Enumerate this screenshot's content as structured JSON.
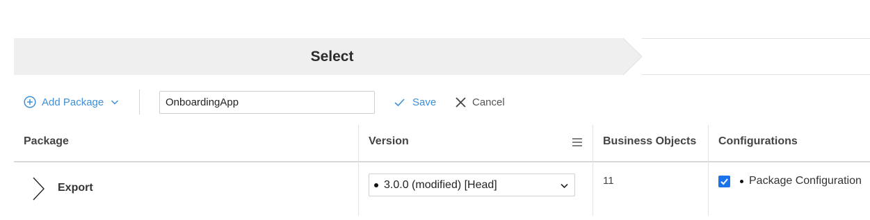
{
  "wizard": {
    "current_step": "Select"
  },
  "toolbar": {
    "add_package_label": "Add Package",
    "name_value": "OnboardingApp",
    "save_label": "Save",
    "cancel_label": "Cancel"
  },
  "table": {
    "columns": [
      "Package",
      "Version",
      "Business Objects",
      "Configurations"
    ],
    "rows": [
      {
        "package": "Export",
        "version": "3.0.0 (modified) [Head]",
        "business_objects": "11",
        "configuration": "Package Configuration",
        "configuration_checked": true
      }
    ]
  },
  "colors": {
    "accent": "#3d8fd6",
    "checkbox": "#1a73e8",
    "step_bg": "#eeefee"
  },
  "icons": [
    "plus-circle-icon",
    "chevron-down-icon",
    "check-icon",
    "close-icon",
    "menu-icon",
    "chevron-right-icon"
  ]
}
